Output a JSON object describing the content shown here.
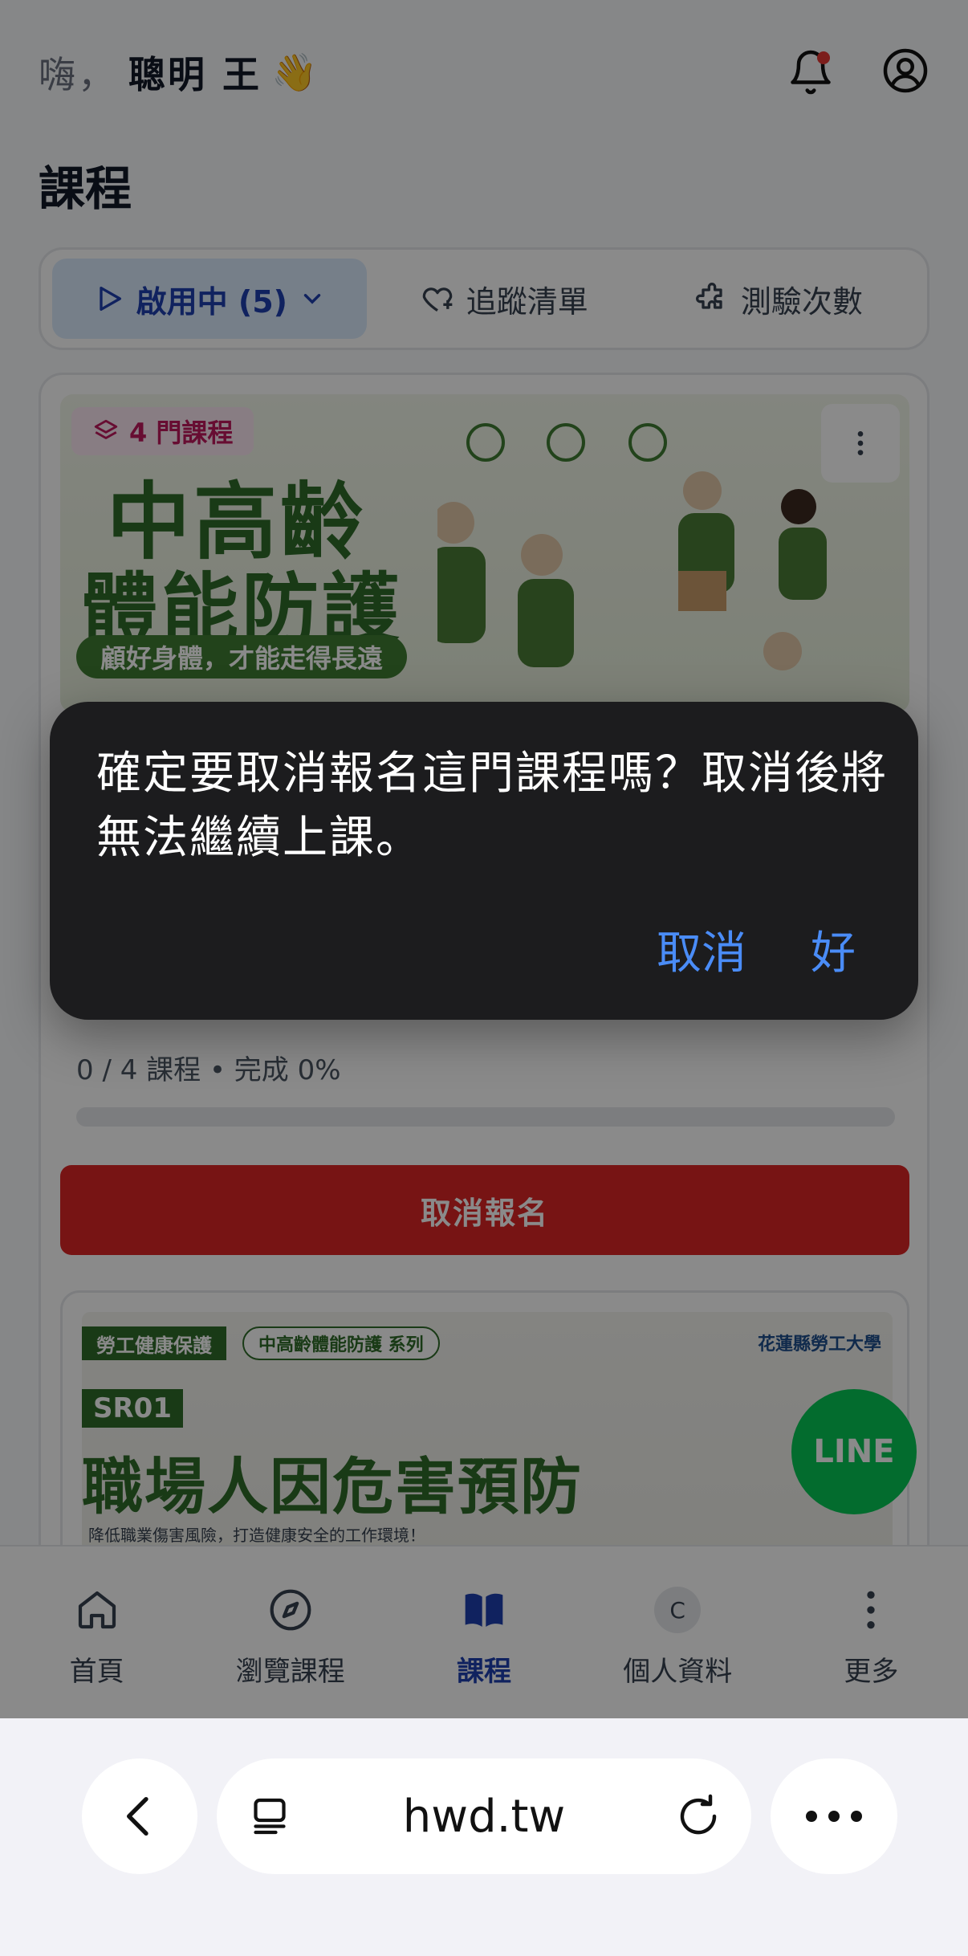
{
  "header": {
    "greeting": "嗨，",
    "user_name": "聰明 王",
    "wave_emoji": "👋",
    "notification_dot_color": "#e53935"
  },
  "section_title": "課程",
  "tabs": [
    {
      "label": "啟用中 (5)",
      "icon": "play-icon",
      "active": true
    },
    {
      "label": "追蹤清單",
      "icon": "heart-icon",
      "active": false
    },
    {
      "label": "測驗次數",
      "icon": "puzzle-icon",
      "active": false
    }
  ],
  "course_card": {
    "badge": "4 門課程",
    "banner_title_line1": "中高齡",
    "banner_title_line2": "體能防護",
    "banner_subtitle": "顧好身體，才能走得長遠",
    "progress_text": "0 / 4 課程 • 完成 0%",
    "progress_fraction": 0,
    "unenroll_button": "取消報名"
  },
  "course_card2": {
    "tag": "勞工健康保護",
    "series": "中高齡體能防護 系列",
    "code": "SR01",
    "title": "職場人因危害預防",
    "subtitle": "降低職業傷害風險，打造健康安全的工作環境！",
    "university": "花蓮縣勞工大學"
  },
  "line_button": "LINE",
  "bottom_nav": [
    {
      "label": "首頁",
      "icon": "home-icon",
      "active": false
    },
    {
      "label": "瀏覽課程",
      "icon": "compass-icon",
      "active": false
    },
    {
      "label": "課程",
      "icon": "book-icon",
      "active": true
    },
    {
      "label": "個人資料",
      "icon": "avatar-icon",
      "avatar_letter": "C",
      "active": false
    },
    {
      "label": "更多",
      "icon": "more-vertical-icon",
      "active": false
    }
  ],
  "alert": {
    "message": "確定要取消報名這門課程嗎？取消後將無法繼續上課。",
    "cancel_label": "取消",
    "ok_label": "好"
  },
  "browser": {
    "url": "hwd.tw"
  },
  "colors": {
    "accent": "#1e40af",
    "danger": "#dc2626",
    "brand_green": "#2f6b2a",
    "line_green": "#06c755",
    "alert_button": "#4a8cf7"
  }
}
